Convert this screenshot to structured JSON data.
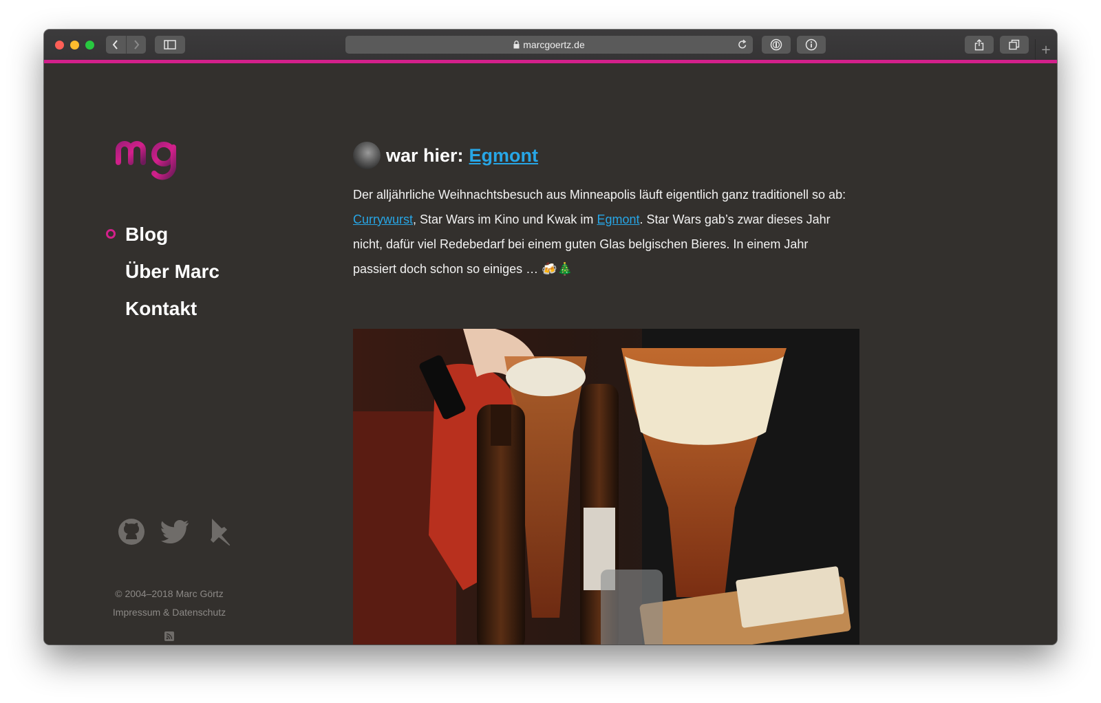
{
  "browser": {
    "url": "marcgoertz.de"
  },
  "site": {
    "logo_text": "mg",
    "nav": [
      {
        "label": "Blog",
        "active": true
      },
      {
        "label": "Über Marc",
        "active": false
      },
      {
        "label": "Kontakt",
        "active": false
      }
    ],
    "social_icons": [
      "github-icon",
      "twitter-icon",
      "pin-icon"
    ],
    "copyright": "© 2004–2018 Marc Görtz",
    "legal_link": "Impressum & Datenschutz",
    "accent_color": "#d3208b",
    "link_color": "#27a6e6"
  },
  "post": {
    "title_prefix": "war hier:",
    "title_link": "Egmont",
    "text_1": "Der alljährliche Weihnachtsbesuch aus Minneapolis läuft eigentlich ganz traditionell so ab: ",
    "link_1": "Currywurst",
    "text_2": ", Star Wars im Kino und Kwak im ",
    "link_2": "Egmont",
    "text_3": ". Star Wars gab’s zwar dieses Jahr nicht, dafür viel Redebedarf bei einem guten Glas belgischen Bieres. In einem Jahr passiert doch schon so einiges … 🍻🎄"
  }
}
